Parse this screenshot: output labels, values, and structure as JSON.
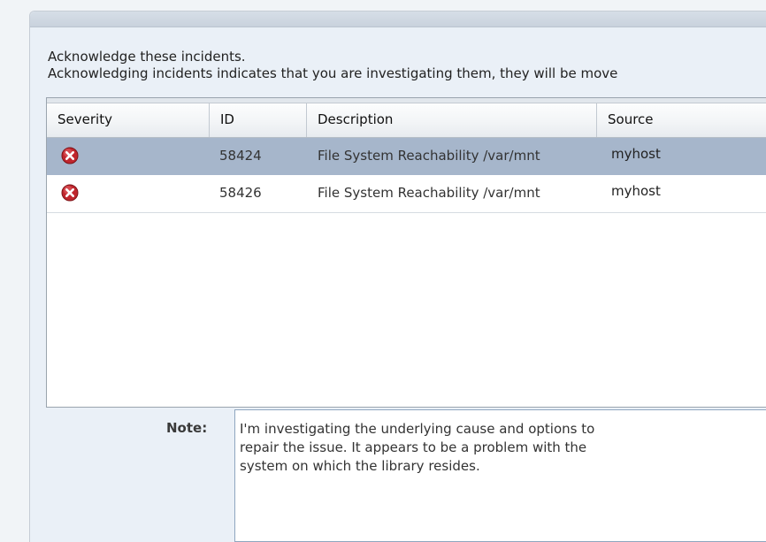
{
  "instructions": {
    "line1": "Acknowledge these incidents.",
    "line2": "Acknowledging incidents indicates that you are investigating them, they will be move"
  },
  "table": {
    "columns": [
      "Severity",
      "ID",
      "Description",
      "Source"
    ],
    "rows": [
      {
        "severity": "critical",
        "id": "58424",
        "description": "File System Reachability /var/mnt",
        "source": "myhost",
        "selected": true
      },
      {
        "severity": "critical",
        "id": "58426",
        "description": "File System Reachability /var/mnt",
        "source": "myhost",
        "selected": false
      }
    ]
  },
  "note": {
    "label": "Note:",
    "value": "I'm investigating the underlying cause and options to\nrepair the issue. It appears to be a problem with the\nsystem on which the library resides."
  },
  "colors": {
    "selected_row": "#a6b6cb",
    "critical_icon": "#c0262d"
  },
  "icons": {
    "severity_critical": "critical-error-icon"
  }
}
